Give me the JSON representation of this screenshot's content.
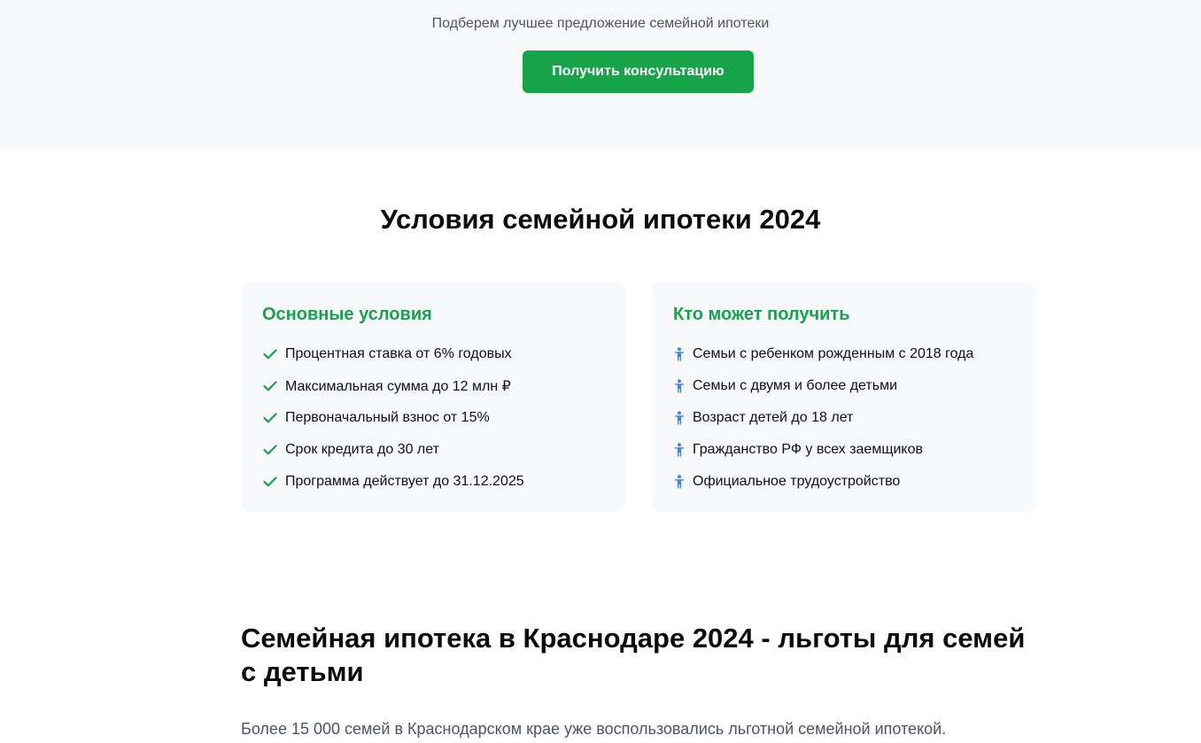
{
  "hero": {
    "subtitle": "Подберем лучшее предложение семейной ипотеки",
    "cta_label": "Получить консультацию"
  },
  "conditions": {
    "title": "Условия семейной ипотеки 2024",
    "main_card": {
      "title": "Основные условия",
      "icon": "check-icon",
      "items": [
        "Процентная ставка от 6% годовых",
        "Максимальная сумма до 12 млн ₽",
        "Первоначальный взнос от 15%",
        "Срок кредита до 30 лет",
        "Программа действует до 31.12.2025"
      ]
    },
    "eligibility_card": {
      "title": "Кто может получить",
      "icon": "person-icon",
      "items": [
        "Семьи с ребенком рожденным с 2018 года",
        "Семьи с двумя и более детьми",
        "Возраст детей до 18 лет",
        "Гражданство РФ у всех заемщиков",
        "Официальное трудоустройство"
      ]
    }
  },
  "krasnodar": {
    "title": "Семейная ипотека в Краснодаре 2024 - льготы для семей с детьми",
    "intro": "Более 15 000 семей в Краснодарском крае уже воспользовались льготной семейной ипотекой."
  },
  "colors": {
    "accent_green": "#16a34a",
    "person_icon_blue": "#3b82f6",
    "card_background": "#f7f8fa"
  }
}
